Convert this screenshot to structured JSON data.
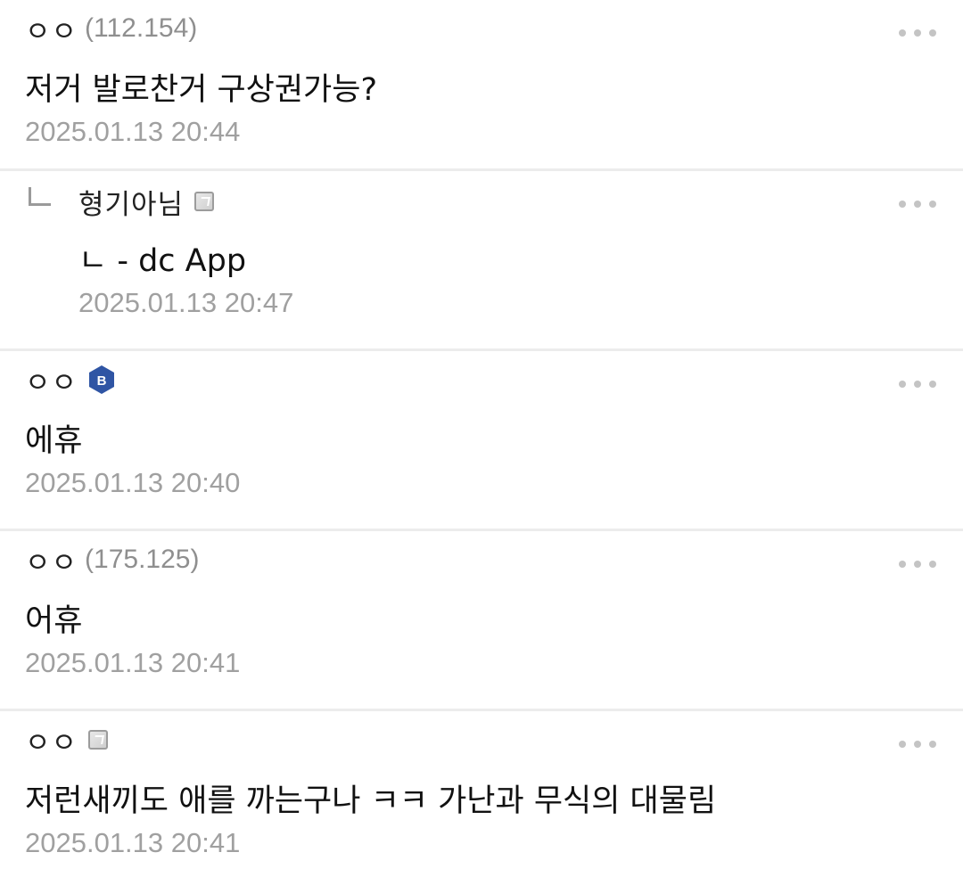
{
  "comments": [
    {
      "nick": "ㅇㅇ",
      "ip": "(112.154)",
      "text": "저거 발로찬거 구상권가능?",
      "date": "2025.01.13 20:44"
    },
    {
      "nick": "형기아님",
      "text": "ㄴ - dc App",
      "date": "2025.01.13 20:47",
      "reply": true,
      "icon": "gallog-icon"
    },
    {
      "nick": "ㅇㅇ",
      "text": "에휴",
      "date": "2025.01.13 20:40",
      "icon": "b-badge-icon",
      "badge_letter": "B",
      "badge_color": "#2f55a4"
    },
    {
      "nick": "ㅇㅇ",
      "ip": "(175.125)",
      "text": "어휴",
      "date": "2025.01.13 20:41"
    },
    {
      "nick": "ㅇㅇ",
      "text": "저런새끼도 애를 까는구나 ㅋㅋ 가난과 무식의 대물림",
      "date": "2025.01.13 20:41",
      "icon": "gallog-icon"
    }
  ],
  "colors": {
    "divider": "#ececec",
    "meta_gray": "#a0a0a0",
    "ip_gray": "#8f8f8f",
    "more_dots": "#c4c4c4"
  }
}
